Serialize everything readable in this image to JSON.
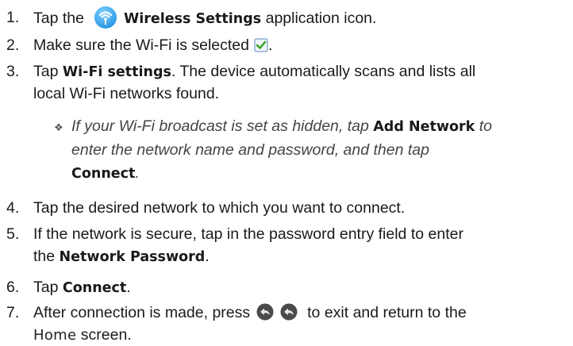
{
  "steps": [
    {
      "num": "1.",
      "before": "Tap the",
      "bold": "Wireless Settings",
      "after": "application icon.",
      "icon": "wireless-settings-icon"
    },
    {
      "num": "2.",
      "text": "Make sure the Wi-Fi is selected",
      "icon": "checkbox-checked-icon"
    },
    {
      "num": "3.",
      "before": "Tap",
      "bold": "Wi-Fi settings",
      "after": ". The device automatically scans and lists all",
      "line2": "local Wi-Fi networks found."
    },
    {
      "num": "4.",
      "text": "Tap the desired network to which you want to connect."
    },
    {
      "num": "5.",
      "line1": "If the network is secure, tap in the password entry field to enter",
      "line2_before": "the",
      "line2_bold": "Network Password",
      "line2_after": "."
    },
    {
      "num": "6.",
      "before": "Tap",
      "bold": "Connect",
      "after": "."
    },
    {
      "num": "7.",
      "before": "After connection is made, press",
      "after": "to exit and return to the",
      "line2": "Home",
      "line2_after": "screen.",
      "icon": "back-button-icon"
    }
  ],
  "note": {
    "bullet": "❖",
    "l1_before": "If your Wi-Fi broadcast is set as hidden, tap",
    "l1_bold": "Add Network",
    "l1_after": "to",
    "l2": "enter the network name and password, and then tap",
    "l3_bold": "Connect",
    "l3_after": "."
  },
  "colors": {
    "accent_blue": "#1e8fe0",
    "check_green": "#3aa52e",
    "back_grey": "#555555"
  }
}
